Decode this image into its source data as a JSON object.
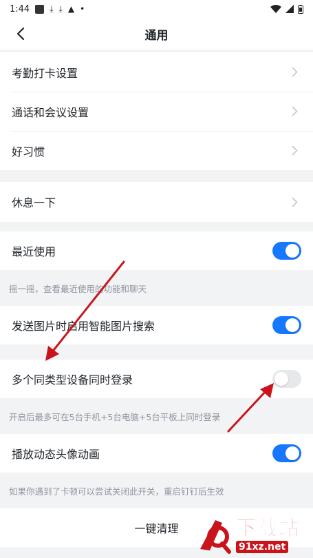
{
  "status_bar": {
    "time": "1:44"
  },
  "nav": {
    "title": "通用"
  },
  "groups": {
    "settings": [
      {
        "label": "考勤打卡设置"
      },
      {
        "label": "通话和会议设置"
      },
      {
        "label": "好习惯"
      }
    ],
    "rest": {
      "label": "休息一下"
    }
  },
  "toggles": {
    "recent": {
      "label": "最近使用",
      "on": true,
      "note": "摇一摇，查看最近使用的功能和聊天"
    },
    "image_search": {
      "label": "发送图片时启用智能图片搜索",
      "on": true
    },
    "multi_login": {
      "label": "多个同类型设备同时登录",
      "on": false,
      "note": "开启后最多可在5台手机+5台电脑+5台平板上同时登录"
    },
    "avatar_anim": {
      "label": "播放动态头像动画",
      "on": true,
      "note": "如果你遇到了卡顿可以尝试关闭此开关，重启钉钉后生效"
    }
  },
  "actions": {
    "clear": "一键清理"
  },
  "watermark": {
    "big": "下载站",
    "small": "91xz.net"
  },
  "colors": {
    "accent": "#1677ff",
    "toggle_off": "#e7e8ea",
    "arrow": "#c9141b"
  }
}
